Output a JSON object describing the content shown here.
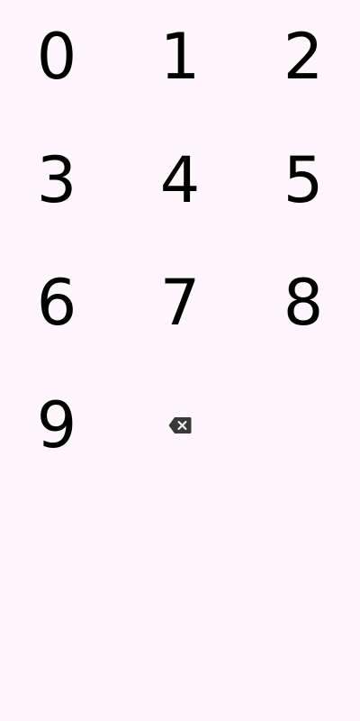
{
  "keypad": {
    "keys": [
      "0",
      "1",
      "2",
      "3",
      "4",
      "5",
      "6",
      "7",
      "8",
      "9"
    ],
    "backspace_icon": "backspace-icon"
  },
  "colors": {
    "background": "#fdf7fc",
    "digit": "#000000",
    "icon": "#3a3a3a"
  }
}
